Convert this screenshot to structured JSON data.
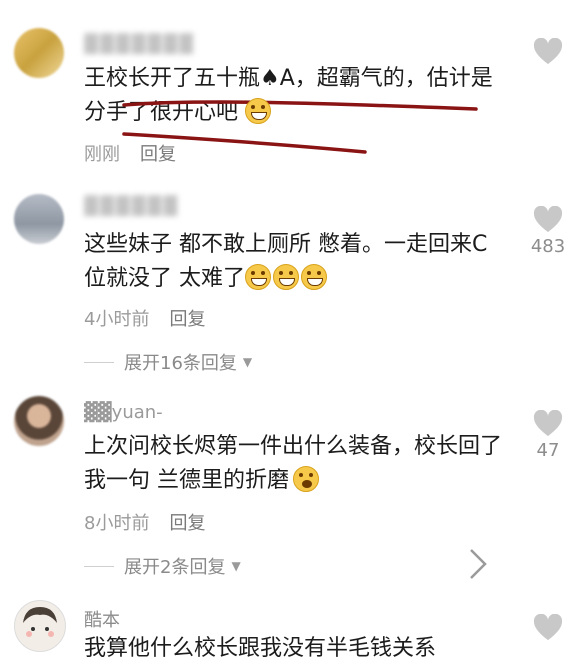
{
  "comments": [
    {
      "username": "▓▓▓▓▓▓▓",
      "text": "王校长开了五十瓶♠A，超霸气的，估计是\n分手了很开心吧",
      "time": "刚刚",
      "reply_label": "回复",
      "likes": ""
    },
    {
      "username": "▓▓▓▓▓▓",
      "text": "这些妹子 都不敢上厕所 憋着。一走回来C\n位就没了 太难了",
      "time": "4小时前",
      "reply_label": "回复",
      "likes": "483",
      "expand_label": "展开16条回复"
    },
    {
      "username": "▓▓yuan-",
      "text": "上次问校长烬第一件出什么装备，校长回了\n我一句 兰德里的折磨",
      "time": "8小时前",
      "reply_label": "回复",
      "likes": "47",
      "expand_label": "展开2条回复"
    },
    {
      "username": "酷本",
      "text": "我算他什么校长跟我没有半毛钱关系",
      "likes": ""
    }
  ],
  "colors": {
    "underline": "#8a1414",
    "heart": "#c8c8c8"
  },
  "icons": {
    "like": "heart-icon",
    "expand": "triangle-down-icon",
    "more": "chevron-right-icon"
  }
}
